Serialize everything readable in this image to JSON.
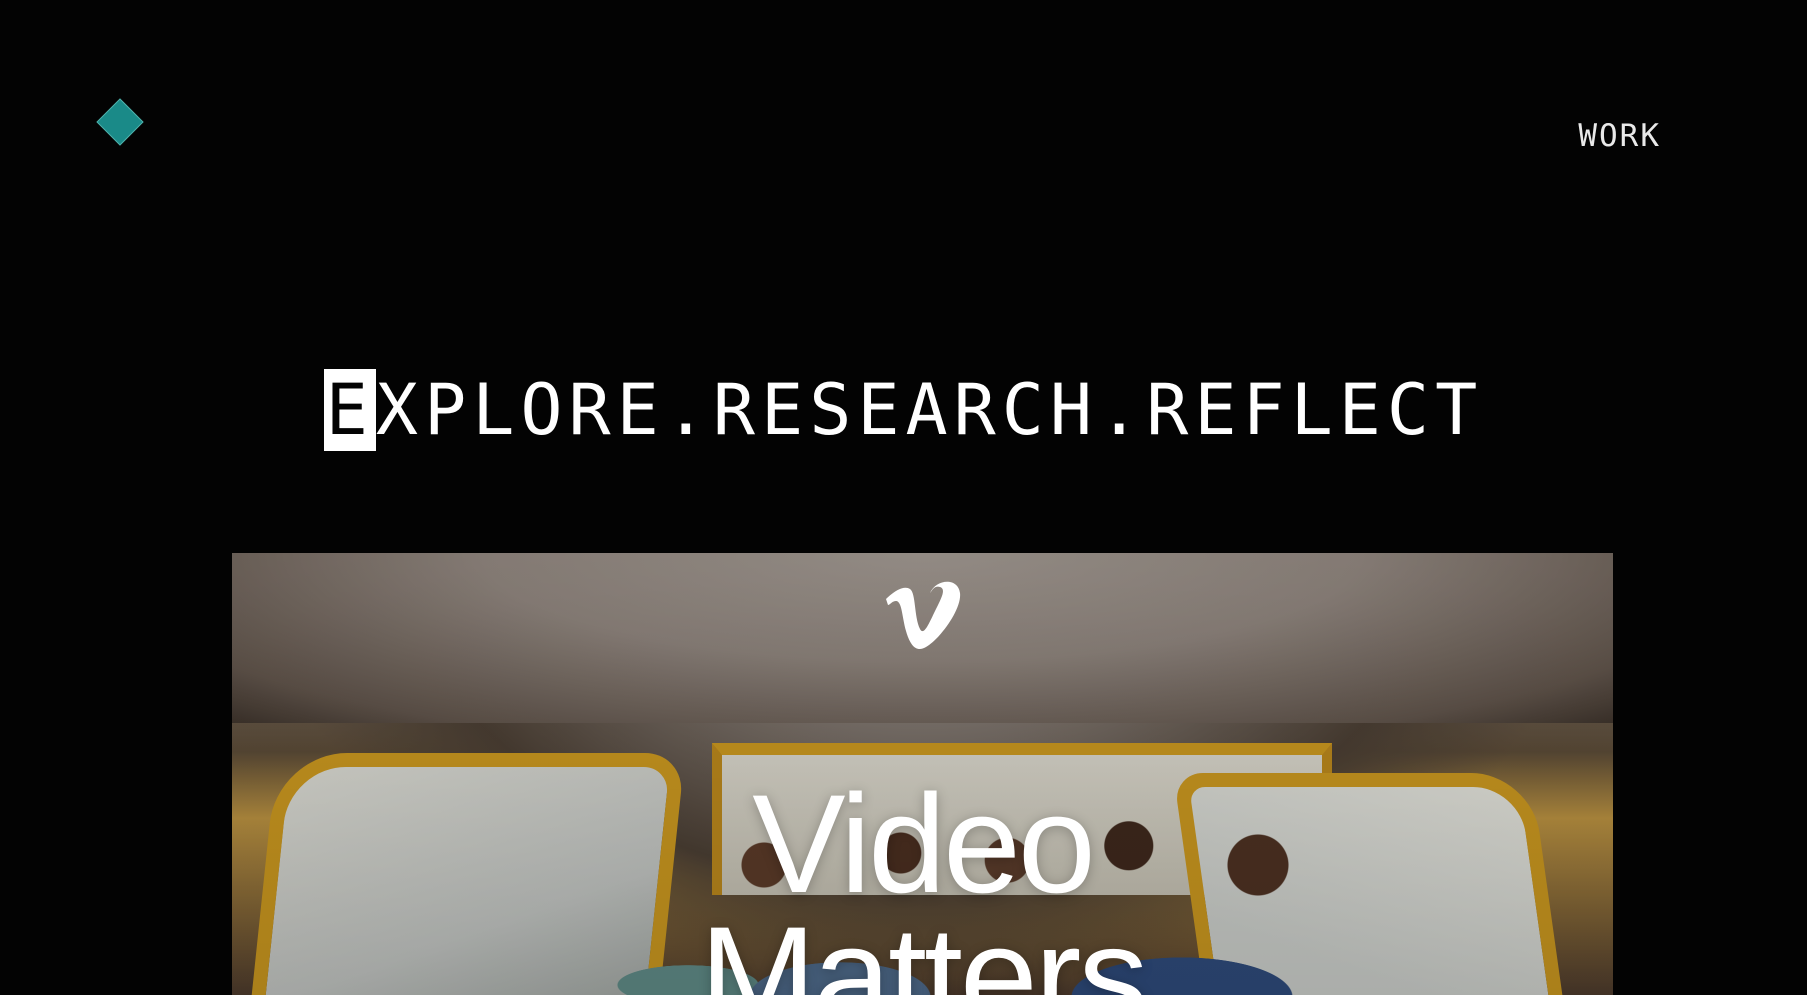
{
  "header": {
    "logo_icon": "diamond-logo-icon",
    "logo_color": "#1a8a88",
    "nav": {
      "work_label": "WORK"
    }
  },
  "hero": {
    "headline_first_letter": "E",
    "headline_rest": "XPLORE.RESEARCH.REFLECT"
  },
  "media": {
    "provider_icon": "vimeo-icon",
    "title_line_1": "Video",
    "title_line_2": "Matters"
  }
}
